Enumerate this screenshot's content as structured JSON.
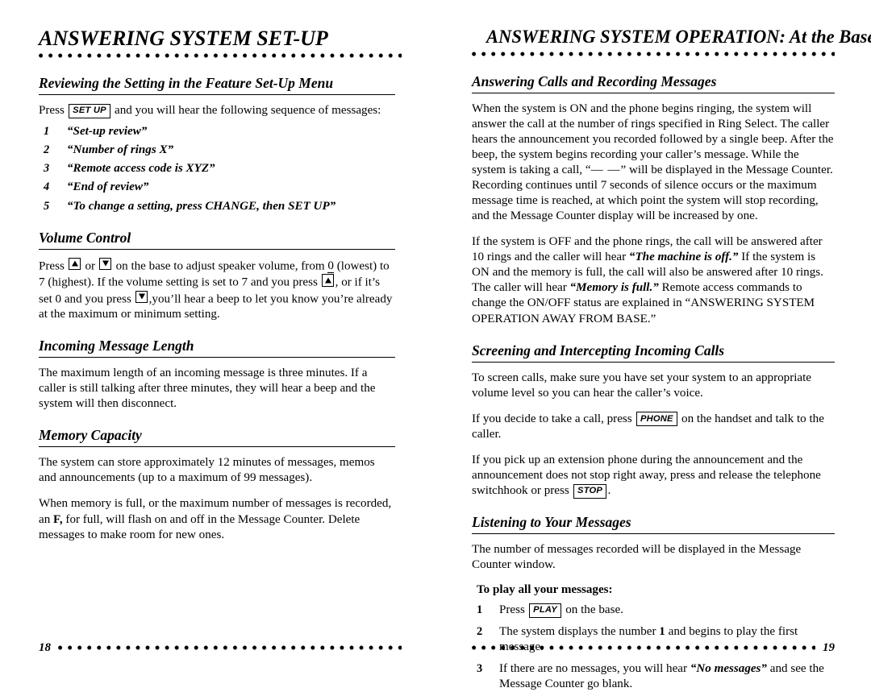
{
  "left_page": {
    "running_head": "ANSWERING SYSTEM SET-UP",
    "folio": "18",
    "sections": [
      {
        "heading": "Reviewing the Setting in the Feature Set-Up Menu",
        "intro_before_key": "Press",
        "key_label": "SET UP",
        "intro_after_key": "and you will hear the following sequence of messages:",
        "items": [
          {
            "num": "1",
            "text": "“Set-up review”"
          },
          {
            "num": "2",
            "text": "“Number of rings X”"
          },
          {
            "num": "3",
            "text": "“Remote access code is XYZ”"
          },
          {
            "num": "4",
            "text": "“End of review”"
          },
          {
            "num": "5",
            "text": "“To change a setting, press CHANGE, then SET UP”"
          }
        ]
      },
      {
        "heading": "Volume Control",
        "para_a1": "Press",
        "para_a2": "or",
        "para_a3": "on the base to adjust speaker volume, from",
        "para_a_zero": "0",
        "para_a4": "(lowest) to 7 (highest).  If the volume setting is set to 7 and you press",
        "para_a5": ", or if it’s set 0 and you press",
        "para_a6": ",you’ll hear a beep to let you know you’re already at the maximum or minimum setting."
      },
      {
        "heading": "Incoming Message Length",
        "para_a": "The maximum length of an incoming message is three minutes. If a caller is still talking after three minutes, they will hear a beep and the system will then disconnect."
      },
      {
        "heading": "Memory Capacity",
        "para_a": "The system can store approximately 12 minutes of messages, memos and announcements (up to a maximum of 99 messages).",
        "para_b1": "When memory is full, or the maximum number of messages is recorded, an",
        "para_b_f": "F,",
        "para_b2": "for full, will flash on and off in the Message Counter. Delete messages to make room for new ones."
      }
    ]
  },
  "right_page": {
    "running_head": "ANSWERING SYSTEM OPERATION: At the Base",
    "folio": "19",
    "sections": [
      {
        "heading": "Answering Calls and Recording Messages",
        "para_a1": "When the system is ON and the phone begins ringing, the system will answer the call at the number of rings specified in Ring Select. The caller hears the announcement you recorded followed by a single beep. After the beep, the system begins recording your caller’s message. While the system is taking a call, “",
        "para_a_dashes": "— —",
        "para_a2": "” will be displayed in the Message Counter. Recording continues until 7 seconds of silence occurs or the maximum message time is reached, at which point the system will stop recording, and the Message Counter display will be increased by one.",
        "para_b1": "If the system is OFF and the phone rings, the call will be answered after 10 rings and the caller will hear",
        "para_b_q1": "“The machine is off.”",
        "para_b2": "If the system is ON and the memory is full, the call will also be answered after 10 rings. The caller will hear",
        "para_b_q2": "“Memory is full.”",
        "para_b3": "Remote access commands to change the ON/OFF status are explained in “ANSWERING SYSTEM OPERATION AWAY FROM BASE.”"
      },
      {
        "heading": "Screening and Intercepting Incoming Calls",
        "para_a": "To screen calls, make sure you have set your system to an appropriate volume level so you can hear the caller’s voice.",
        "para_b1": "If you decide to take a call, press",
        "para_b_key": "PHONE",
        "para_b2": "on the handset and talk to the caller.",
        "para_c1": "If you pick up an extension phone during the announcement and the announcement does not stop right away, press and release the telephone switchhook or press",
        "para_c_key": "STOP",
        "para_c2": "."
      },
      {
        "heading": "Listening to Your Messages",
        "para_a": "The number of messages recorded will be displayed in the Message Counter window.",
        "subhead": "To play all your messages:",
        "steps": [
          {
            "num": "1",
            "pre": "Press",
            "key": "PLAY",
            "post": "on the base."
          },
          {
            "num": "2",
            "pre": "The system displays the number",
            "bold": "1",
            "post": "and begins to play the first message."
          },
          {
            "num": "3",
            "pre": "If there are no messages, you will hear",
            "quote": "“No messages”",
            "post": "and see the Message Counter go blank."
          }
        ]
      }
    ]
  }
}
